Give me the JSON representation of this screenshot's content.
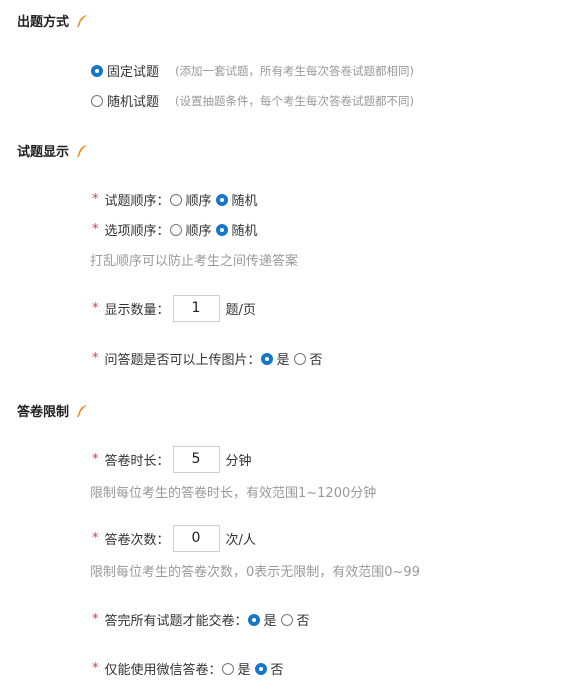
{
  "sections": {
    "question_mode": {
      "title": "出题方式",
      "icon": "feather-icon"
    },
    "question_display": {
      "title": "试题显示",
      "icon": "feather-icon"
    },
    "answer_limits": {
      "title": "答卷限制",
      "icon": "feather-icon"
    }
  },
  "question_mode": {
    "fixed": {
      "label": "固定试题",
      "hint": "(添加一套试题，所有考生每次答卷试题都相同)",
      "selected": true
    },
    "random": {
      "label": "随机试题",
      "hint": "(设置抽题条件，每个考生每次答卷试题都不同)",
      "selected": false
    }
  },
  "display": {
    "question_order": {
      "label": "试题顺序：",
      "options": [
        "顺序",
        "随机"
      ],
      "selected": "随机"
    },
    "option_order": {
      "label": "选项顺序：",
      "options": [
        "顺序",
        "随机"
      ],
      "selected": "随机"
    },
    "order_hint": "打乱顺序可以防止考生之间传递答案",
    "count": {
      "label": "显示数量：",
      "value": "1",
      "unit": "题/页"
    },
    "upload_image": {
      "label": "问答题是否可以上传图片：",
      "options": [
        "是",
        "否"
      ],
      "selected": "是"
    }
  },
  "limits": {
    "duration": {
      "label": "答卷时长：",
      "value": "5",
      "unit": "分钟",
      "hint": "限制每位考生的答卷时长，有效范围1~1200分钟"
    },
    "attempts": {
      "label": "答卷次数：",
      "value": "0",
      "unit": "次/人",
      "hint": "限制每位考生的答卷次数，0表示无限制，有效范围0~99"
    },
    "must_complete": {
      "label": "答完所有试题才能交卷：",
      "options": [
        "是",
        "否"
      ],
      "selected": "是"
    },
    "wechat_only": {
      "label": "仅能使用微信答卷：",
      "options": [
        "是",
        "否"
      ],
      "selected": "否"
    }
  },
  "required_mark": "*",
  "colors": {
    "accent": "#1677c9",
    "required": "#e4393c",
    "icon": "#f08a1c",
    "hint": "#999999"
  }
}
